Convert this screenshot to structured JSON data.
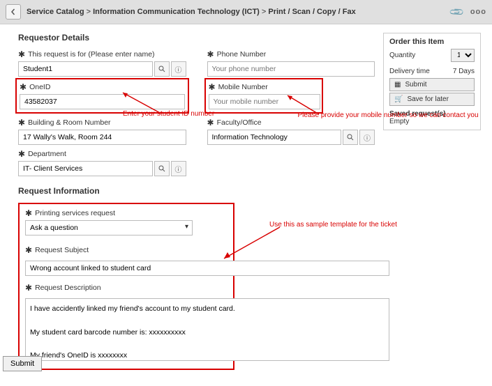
{
  "breadcrumb": {
    "root": "Service Catalog",
    "mid": "Information Communication Technology (ICT)",
    "leaf": "Print / Scan / Copy / Fax"
  },
  "sections": {
    "requestor": "Requestor Details",
    "reqinfo": "Request Information"
  },
  "labels": {
    "requestFor": "This request is for (Please enter name)",
    "phone": "Phone Number",
    "oneId": "OneID",
    "mobile": "Mobile Number",
    "building": "Building & Room Number",
    "faculty": "Faculty/Office",
    "department": "Department",
    "printing": "Printing services request",
    "subject": "Request Subject",
    "description": "Request Description"
  },
  "values": {
    "requestFor": "Student1",
    "oneId": "43582037",
    "building": "17 Wally's Walk, Room 244",
    "faculty": "Information Technology",
    "department": "IT- Client Services",
    "printing": "Ask a question",
    "subject": "Wrong account linked to student card",
    "description": "I have accidently linked my friend's account to my student card.\n\nMy student card barcode number is: xxxxxxxxxx\n\nMy friend's OneID is xxxxxxxx\n\nPlease assist with unlink the wrong account."
  },
  "placeholders": {
    "phone": "Your phone number",
    "mobile": "Your mobile number"
  },
  "annotations": {
    "oneId": "Enter your student ID number",
    "mobile": "Please provide your mobile number so we can contact you",
    "template": "Use this as sample template for the ticket"
  },
  "sidebar": {
    "orderTitle": "Order this Item",
    "quantityLabel": "Quantity",
    "quantity": "1",
    "deliveryLabel": "Delivery time",
    "deliveryValue": "7 Days",
    "submit": "Submit",
    "saveLater": "Save for later",
    "savedTitle": "Saved request(s)",
    "savedEmpty": "Empty"
  },
  "footer": {
    "submit": "Submit"
  }
}
